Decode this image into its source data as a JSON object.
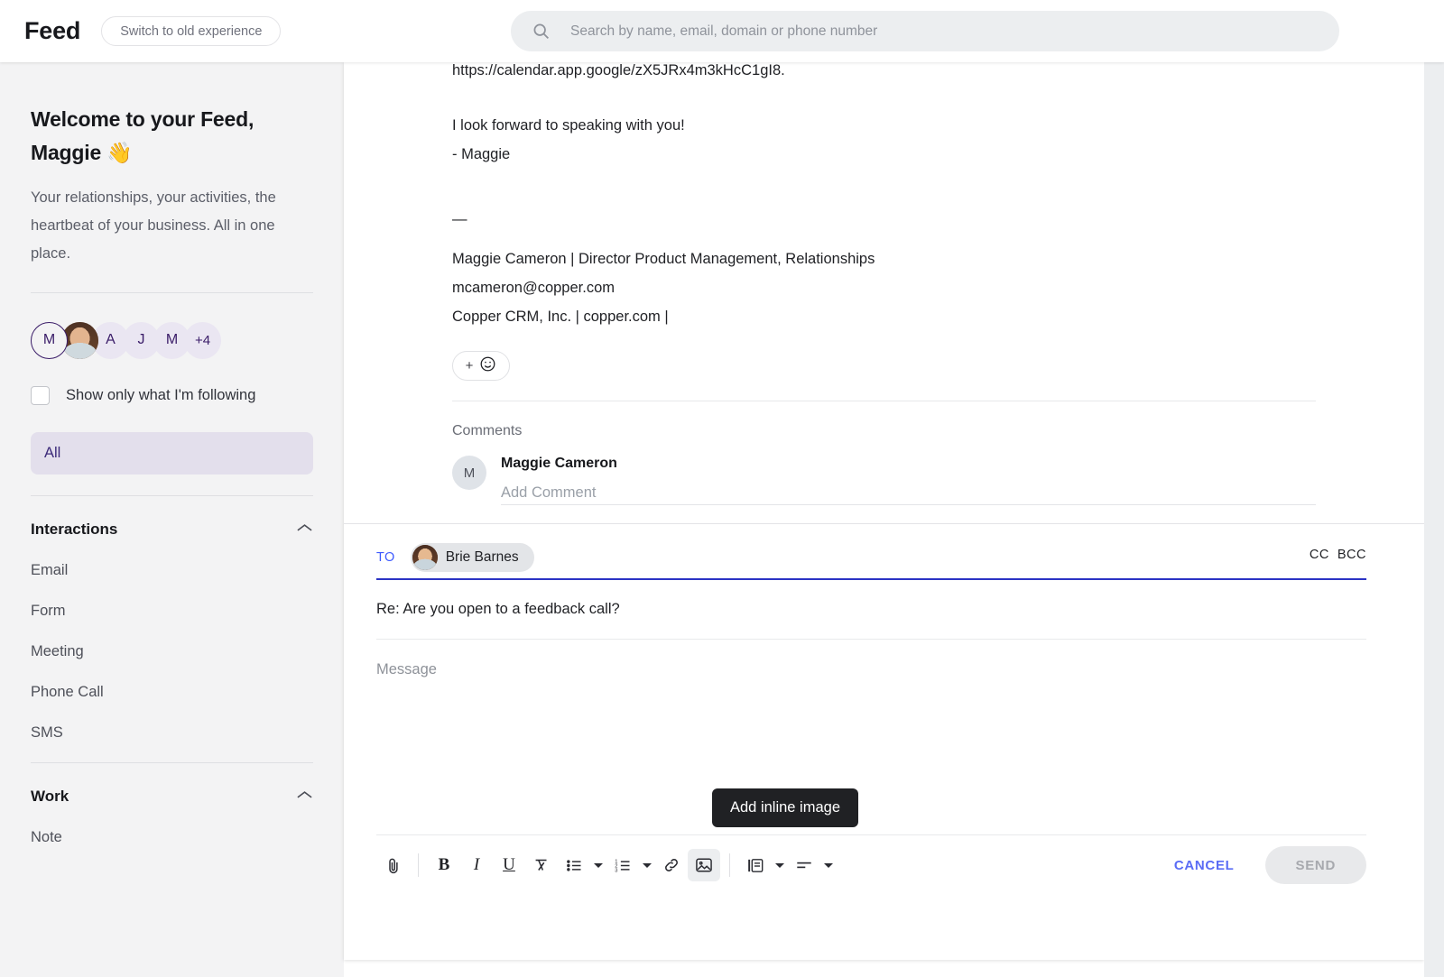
{
  "topbar": {
    "brand": "Feed",
    "switch_label": "Switch to old experience",
    "search_placeholder": "Search by name, email, domain or phone number",
    "search_value": "",
    "search_icon": "search-icon"
  },
  "sidebar": {
    "welcome_title": "Welcome to your Feed, Maggie 👋",
    "welcome_sub": "Your relationships, your activities, the heartbeat of your business. All in one place.",
    "avatars": [
      {
        "label": "M",
        "type": "initial-selected"
      },
      {
        "label": "",
        "type": "photo"
      },
      {
        "label": "A",
        "type": "initial"
      },
      {
        "label": "J",
        "type": "initial"
      },
      {
        "label": "M",
        "type": "initial"
      },
      {
        "label": "+4",
        "type": "overflow"
      }
    ],
    "follow_filter_label": "Show only what I'm following",
    "follow_filter_checked": false,
    "all_label": "All",
    "sections": [
      {
        "title": "Interactions",
        "collapse_icon": "chevron-up-icon",
        "items": [
          "Email",
          "Form",
          "Meeting",
          "Phone Call",
          "SMS"
        ]
      },
      {
        "title": "Work",
        "collapse_icon": "chevron-up-icon",
        "items": [
          "Note"
        ]
      }
    ]
  },
  "email": {
    "lines": [
      "https://calendar.app.google/zX5JRx4m3kHcC1gI8.",
      "I look forward to speaking with you!",
      "- Maggie"
    ],
    "signature_dash": "—",
    "signature": [
      "Maggie Cameron | Director Product Management, Relationships",
      "mcameron@copper.com",
      "Copper CRM, Inc. | copper.com |"
    ],
    "reaction_plus": "+",
    "reaction_emoji": "☺"
  },
  "comments": {
    "label": "Comments",
    "author_initial": "M",
    "author_name": "Maggie Cameron",
    "input_placeholder": "Add Comment",
    "input_value": ""
  },
  "compose": {
    "to_label": "TO",
    "recipient": "Brie Barnes",
    "cc_label": "CC",
    "bcc_label": "BCC",
    "subject": "Re: Are you open to a feedback call?",
    "message_placeholder": "Message",
    "message_value": "",
    "tooltip": "Add inline image",
    "cancel_label": "CANCEL",
    "send_label": "SEND",
    "toolbar_icons": [
      "attachment-icon",
      "bold-icon",
      "italic-icon",
      "underline-icon",
      "clear-formatting-icon",
      "bulleted-list-icon",
      "numbered-list-icon",
      "link-icon",
      "inline-image-icon",
      "template-icon",
      "align-icon"
    ]
  },
  "colors": {
    "accent_blue": "#3d5afe",
    "cancel_blue": "#5a6cf5",
    "sidebar_bg": "#f3f3f4",
    "all_pill_bg": "#e3dfec",
    "all_pill_text": "#3c2a7a",
    "tooltip_bg": "#202124"
  }
}
